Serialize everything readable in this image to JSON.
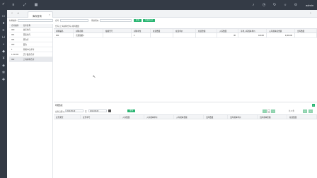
{
  "sidebar_icons": [
    "logo-icon",
    "monitor-icon",
    "person-icon",
    "list-icon",
    "cart-icon",
    "briefcase-icon",
    "box-icon",
    "money-icon",
    "tag-icon",
    "gear-icon",
    "puzzle-icon"
  ],
  "topbar": {
    "user_name": "admin"
  },
  "tabs": {
    "active_label": "库存查询"
  },
  "filter": {
    "material_label": "材料编码",
    "warehouse_label": "仓库",
    "type_label": "期初期末",
    "query_btn": "查询",
    "export_btn": "导出Excel"
  },
  "warehouse_table": {
    "headers": [
      "仓库编码",
      "仓库名称"
    ],
    "rows": [
      [
        "000",
        "总库仓库"
      ],
      [
        "001",
        "西街仓库"
      ],
      [
        "004",
        "原仓库"
      ],
      [
        "003",
        "面仓"
      ],
      [
        "1",
        "测验中心库存"
      ],
      [
        "1.01.002",
        "辽宁股份仓库"
      ],
      [
        "002",
        "上海材料仓库"
      ]
    ],
    "selected_row": 6
  },
  "main_grid": {
    "breadcrumb": "仓库 [上海材料仓库] 材料数据",
    "headers": [
      "材料编码",
      "材料名称",
      "规格型号",
      "材料单位",
      "在途数量",
      "在途单价",
      "在途金额",
      "入库数量",
      "平均入库成本单价",
      "入库成本总金额",
      "出库数量"
    ],
    "rows": [
      [
        "001",
        "光缆线缆1",
        "",
        "1",
        "",
        "",
        "",
        "30",
        "100.00",
        "3,000.00",
        ""
      ]
    ]
  },
  "bottom": {
    "title": "明细数据",
    "date_label": "业务日期 从",
    "date_from": "2019-05-20",
    "date_to_label": "至",
    "date_to": "2019-06-06",
    "query_btn": "查询",
    "headers": [
      "业务类型",
      "业务单号",
      "入库数量",
      "入库成本单价",
      "入库成本金额",
      "出库数量",
      "出库成本单价",
      "出库成本金额",
      "在途数量"
    ],
    "pager_text": "共 0 条",
    "pager_page": "1"
  }
}
